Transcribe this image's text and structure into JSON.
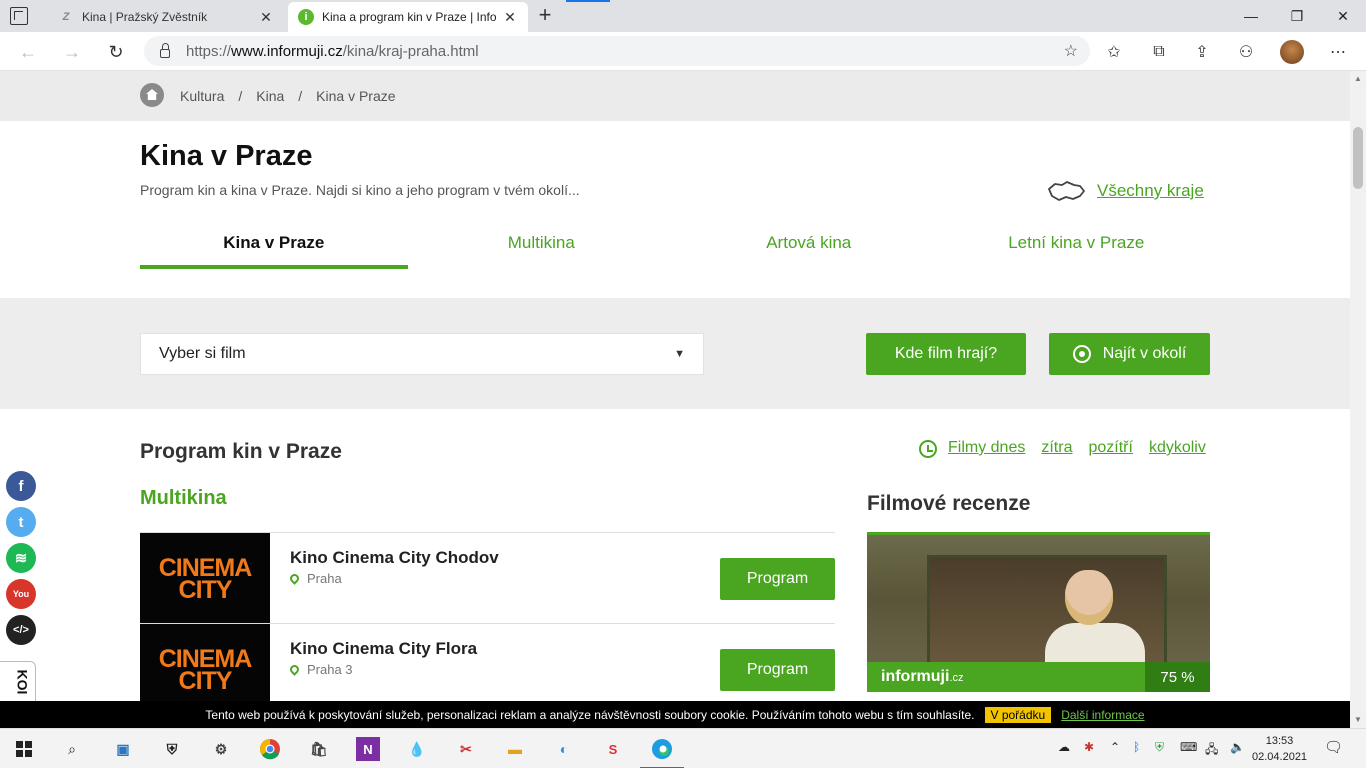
{
  "browser": {
    "tabs": [
      {
        "title": "Kina | Pražský Zvěstník",
        "active": false
      },
      {
        "title": "Kina a program kin v Praze | Info",
        "active": true
      }
    ],
    "url_prefix": "https://",
    "url_host": "www.informuji.cz",
    "url_path": "/kina/kraj-praha.html"
  },
  "breadcrumb": [
    "Kultura",
    "Kina",
    "Kina v Praze"
  ],
  "hero": {
    "title": "Kina v Praze",
    "subtitle": "Program kin a kina v Praze. Najdi si kino a jeho program v tvém okolí...",
    "all_regions": "Všechny kraje"
  },
  "subtabs": [
    {
      "label": "Kina v Praze",
      "active": true
    },
    {
      "label": "Multikina",
      "active": false
    },
    {
      "label": "Artová kina",
      "active": false
    },
    {
      "label": "Letní kina v Praze",
      "active": false
    }
  ],
  "search": {
    "select_value": "Vyber si film",
    "where_button": "Kde film hrají?",
    "near_button": "Najít v okolí"
  },
  "program": {
    "title": "Program kin v Praze",
    "days": [
      "Filmy dnes",
      "zítra",
      "pozítří",
      "kdykoliv"
    ],
    "section": "Multikina",
    "cinemas": [
      {
        "logo_line1": "CINEMA",
        "logo_line2": "CITY",
        "name": "Kino Cinema City Chodov",
        "location": "Praha",
        "button": "Program"
      },
      {
        "logo_line1": "CINEMA",
        "logo_line2": "CITY",
        "name": "Kino Cinema City Flora",
        "location": "Praha 3",
        "button": "Program"
      }
    ]
  },
  "reviews": {
    "title": "Filmové recenze",
    "brand": "informuji",
    "brand_suffix": ".cz",
    "score": "75 %"
  },
  "side_tab": "KOI",
  "cookie": {
    "text": "Tento web používá k poskytování služeb, personalizaci reklam a analýze návštěvnosti soubory cookie. Používáním tohoto webu s tím souhlasíte.",
    "ok": "V pořádku",
    "more": "Další informace"
  },
  "taskbar": {
    "time": "13:53",
    "date": "02.04.2021"
  },
  "colors": {
    "accent": "#4aa521",
    "cinema_logo": "#f07a1a"
  }
}
